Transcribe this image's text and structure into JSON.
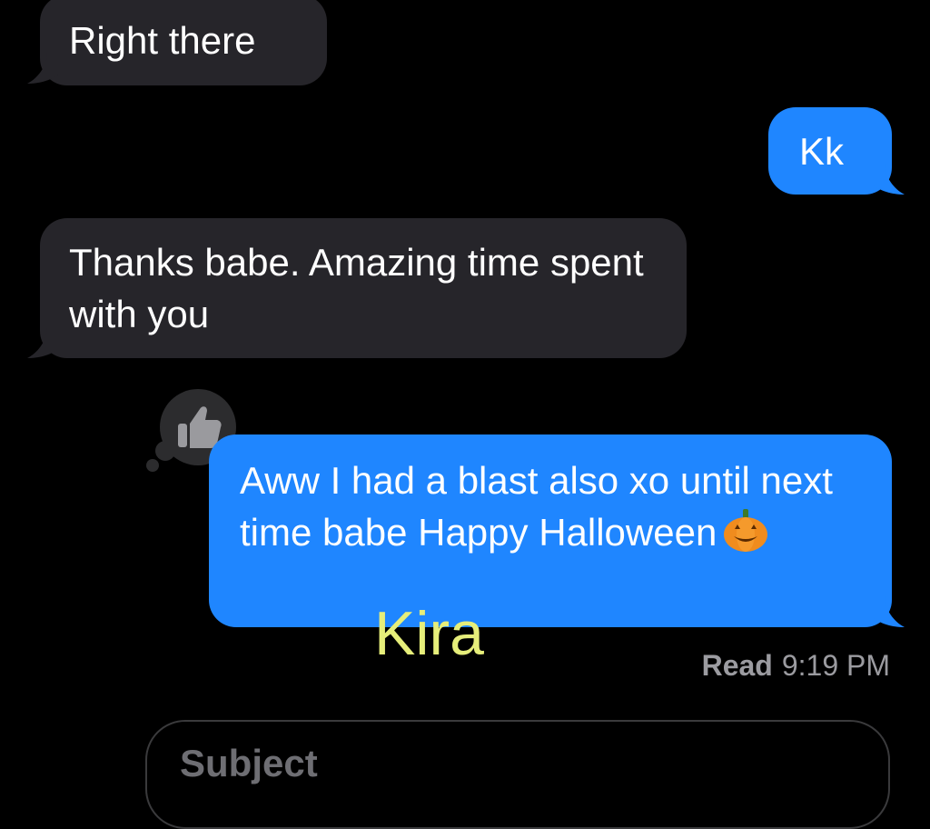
{
  "conversation": {
    "messages": [
      {
        "sender": "received",
        "text": "Right there"
      },
      {
        "sender": "sent",
        "text": "Kk"
      },
      {
        "sender": "received",
        "text": "Thanks babe. Amazing time spent with you"
      },
      {
        "sender": "sent",
        "text": "Aww I had a blast also xo until next time babe Happy Halloween",
        "emoji": "pumpkin-emoji"
      }
    ]
  },
  "tapback": {
    "icon": "thumbs-up-icon"
  },
  "read_receipt": {
    "label": "Read",
    "time": "9:19 PM"
  },
  "watermark": {
    "text": "Kira"
  },
  "compose": {
    "placeholder": "Subject"
  },
  "colors": {
    "background": "#000000",
    "received_bubble": "#26252a",
    "sent_bubble": "#1f86ff",
    "watermark": "#e6ee7a",
    "secondary_text": "#9b9ba0"
  }
}
